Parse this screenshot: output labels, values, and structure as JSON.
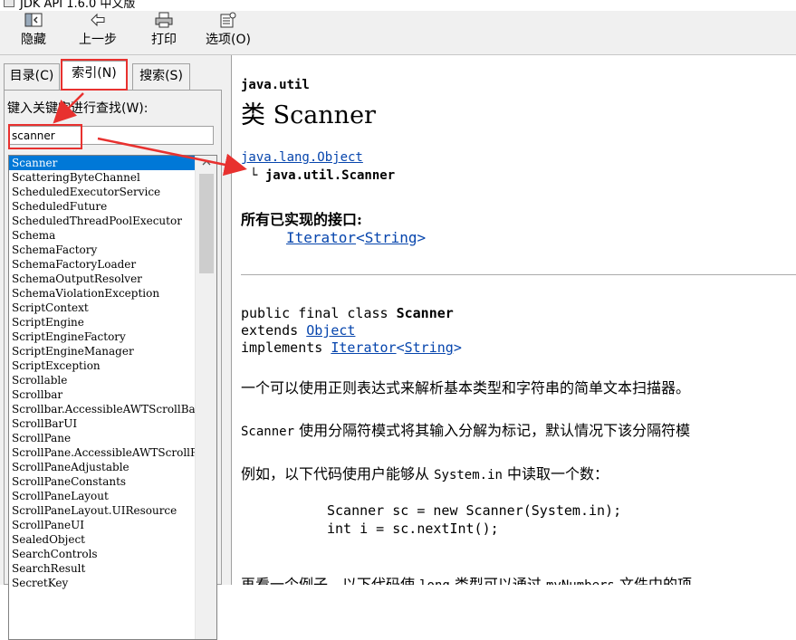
{
  "window": {
    "title": "JDK API 1.6.0 中文版"
  },
  "toolbar": {
    "hide_label": "隐藏",
    "back_label": "上一步",
    "print_label": "打印",
    "options_label": "选项(O)"
  },
  "tabs": [
    {
      "label": "目录(C)"
    },
    {
      "label": "索引(N)"
    },
    {
      "label": "搜索(S)"
    }
  ],
  "index": {
    "keyword_label": "键入关键字进行查找(W):",
    "keyword_value": "scanner",
    "items": [
      "Scanner",
      "ScatteringByteChannel",
      "ScheduledExecutorService",
      "ScheduledFuture",
      "ScheduledThreadPoolExecutor",
      "Schema",
      "SchemaFactory",
      "SchemaFactoryLoader",
      "SchemaOutputResolver",
      "SchemaViolationException",
      "ScriptContext",
      "ScriptEngine",
      "ScriptEngineFactory",
      "ScriptEngineManager",
      "ScriptException",
      "Scrollable",
      "Scrollbar",
      "Scrollbar.AccessibleAWTScrollBar",
      "ScrollBarUI",
      "ScrollPane",
      "ScrollPane.AccessibleAWTScrollPane",
      "ScrollPaneAdjustable",
      "ScrollPaneConstants",
      "ScrollPaneLayout",
      "ScrollPaneLayout.UIResource",
      "ScrollPaneUI",
      "SealedObject",
      "SearchControls",
      "SearchResult",
      "SecretKey"
    ]
  },
  "doc": {
    "package": "java.util",
    "class_title": "类 Scanner",
    "hierarchy_parent": "java.lang.Object",
    "hierarchy_child": "└ java.util.Scanner",
    "interfaces_heading": "所有已实现的接口:",
    "iface_name": "Iterator",
    "iface_type": "String",
    "decl_line1": "public final class",
    "decl_class": "Scanner",
    "decl_extends_kw": "extends",
    "decl_extends": "Object",
    "decl_implements_kw": "implements",
    "decl_implements": "Iterator",
    "decl_implements_type": "String",
    "para1": "一个可以使用正则表达式来解析基本类型和字符串的简单文本扫描器。",
    "para2_code": "Scanner",
    "para2_text": " 使用分隔符模式将其输入分解为标记，默认情况下该分隔符模",
    "para3_text_a": "例如，以下代码使用户能够从 ",
    "para3_code": "System.in",
    "para3_text_b": " 中读取一个数：",
    "code_line1": "Scanner sc = new Scanner(System.in);",
    "code_line2": "int i = sc.nextInt();",
    "para4_text_a": "再看一个例子，以下代码使 ",
    "para4_code_a": "long",
    "para4_text_b": " 类型可以通过 ",
    "para4_code_b": "myNumbers",
    "para4_text_c": " 文件中的项"
  },
  "annotations": {
    "highlight_color": "#e8312f"
  }
}
